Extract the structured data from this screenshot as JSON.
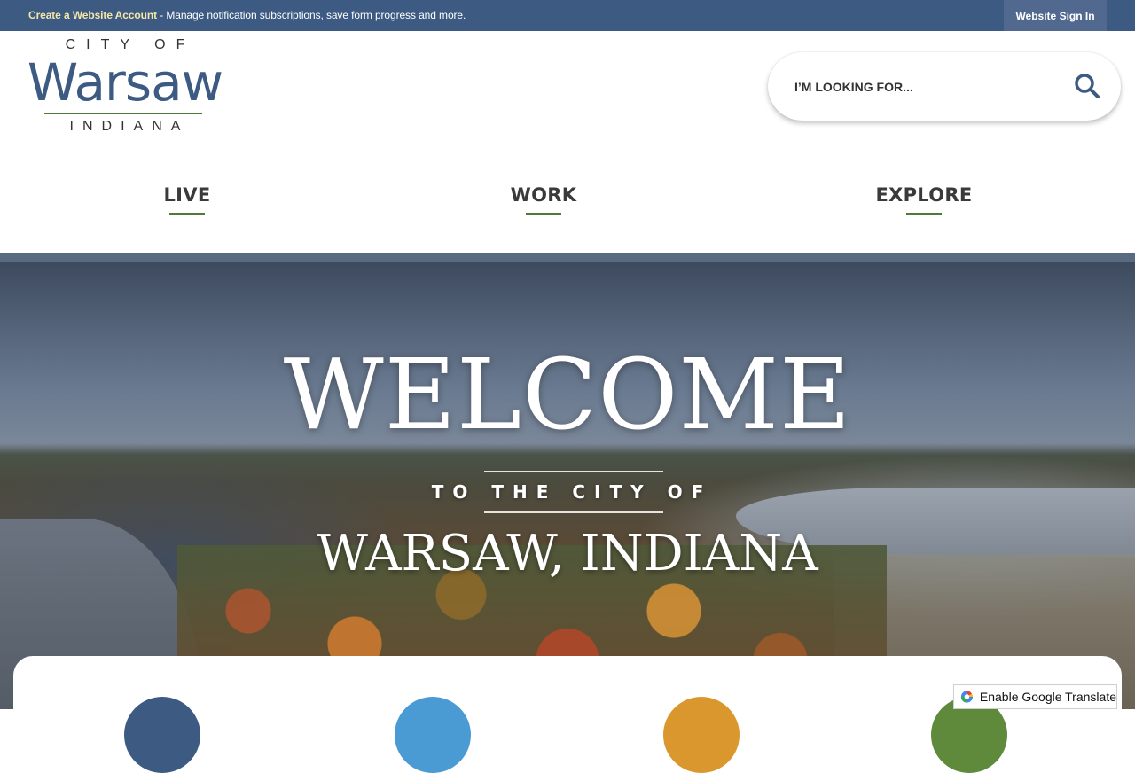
{
  "topbar": {
    "create_account_link": "Create a Website Account",
    "message": " - Manage notification subscriptions, save form progress and more.",
    "signin_label": "Website Sign In"
  },
  "logo": {
    "top": "CITY OF",
    "main": "Warsaw",
    "bottom": "INDIANA"
  },
  "search": {
    "placeholder": "I’M LOOKING FOR...",
    "icon": "search-icon"
  },
  "nav": {
    "items": [
      {
        "label": "LIVE"
      },
      {
        "label": "WORK"
      },
      {
        "label": "EXPLORE"
      }
    ]
  },
  "hero": {
    "heading": "WELCOME",
    "subheading": "TO THE CITY OF",
    "city": "WARSAW, INDIANA"
  },
  "quick_links": {
    "circle_colors": [
      "#3c5a82",
      "#4a9ad4",
      "#d9972e",
      "#5f8a3c"
    ]
  },
  "translate": {
    "label": "Enable Google Translate",
    "icon": "google-translate-icon"
  },
  "colors": {
    "brand_blue": "#3c5a82",
    "accent_green": "#4e7a3a",
    "account_link": "#f5e6a8"
  }
}
